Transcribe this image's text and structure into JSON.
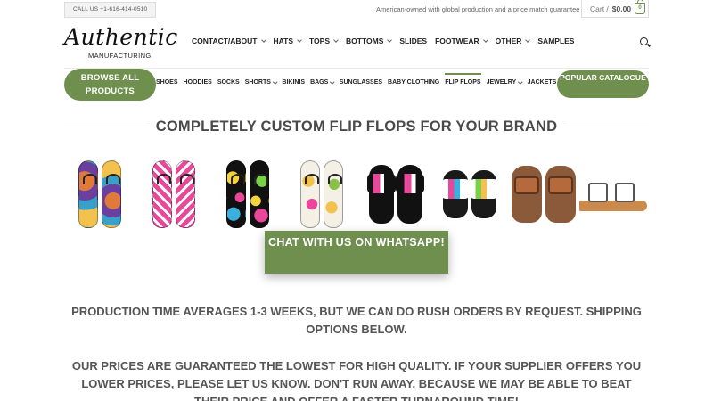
{
  "topbar": {
    "call": "CALL US +1-616-414-0510",
    "tagline": "American-owned with global production and a price match guarantee",
    "cart_label": "Cart /",
    "cart_total": "$0.00",
    "cart_count": "0"
  },
  "header": {
    "logo_main": "Authentic",
    "logo_sub": "MANUFACTURING",
    "nav": [
      {
        "label": "CONTACT/ABOUT",
        "dropdown": true
      },
      {
        "label": "HATS",
        "dropdown": true
      },
      {
        "label": "TOPS",
        "dropdown": true
      },
      {
        "label": "BOTTOMS",
        "dropdown": true
      },
      {
        "label": "SLIDES",
        "dropdown": false
      },
      {
        "label": "FOOTWEAR",
        "dropdown": true
      },
      {
        "label": "OTHER",
        "dropdown": true
      },
      {
        "label": "SAMPLES",
        "dropdown": false
      }
    ],
    "search_icon": "search-icon"
  },
  "subnav": {
    "browse": "BROWSE ALL PRODUCTS",
    "popular": "POPULAR CATALOGUE",
    "items": [
      {
        "label": "SHOES",
        "dropdown": false
      },
      {
        "label": "HOODIES",
        "dropdown": false
      },
      {
        "label": "SOCKS",
        "dropdown": false
      },
      {
        "label": "SHORTS",
        "dropdown": true
      },
      {
        "label": "BIKINIS",
        "dropdown": false
      },
      {
        "label": "BAGS",
        "dropdown": true
      },
      {
        "label": "SUNGLASSES",
        "dropdown": false
      },
      {
        "label": "BABY CLOTHING",
        "dropdown": false
      },
      {
        "label": "FLIP FLOPS",
        "dropdown": false,
        "active": true
      },
      {
        "label": "JEWELRY",
        "dropdown": true
      },
      {
        "label": "JACKETS",
        "dropdown": true
      }
    ]
  },
  "main": {
    "section_title": "COMPLETELY CUSTOM FLIP FLOPS FOR YOUR BRAND",
    "chat_button": "CHAT WITH US ON WHATSAPP!",
    "para1": "PRODUCTION TIME AVERAGES 1-3 WEEKS, BUT WE CAN DO RUSH ORDERS BY REQUEST. SHIPPING OPTIONS BELOW.",
    "para2": "OUR PRICES ARE GUARANTEED THE LOWEST FOR HIGH QUALITY. IF YOUR SUPPLIER OFFERS YOU LOWER PRICES, PLEASE LET US KNOW. DON'T RUN AWAY, BECAUSE WE MAY BE ABLE TO BEAT THEIR PRICE AND OFFER A FASTER TURNAROUND TIME!"
  },
  "colors": {
    "accent_green": "#6f8f4e",
    "text_dark": "#222222",
    "text_body": "#555555"
  }
}
